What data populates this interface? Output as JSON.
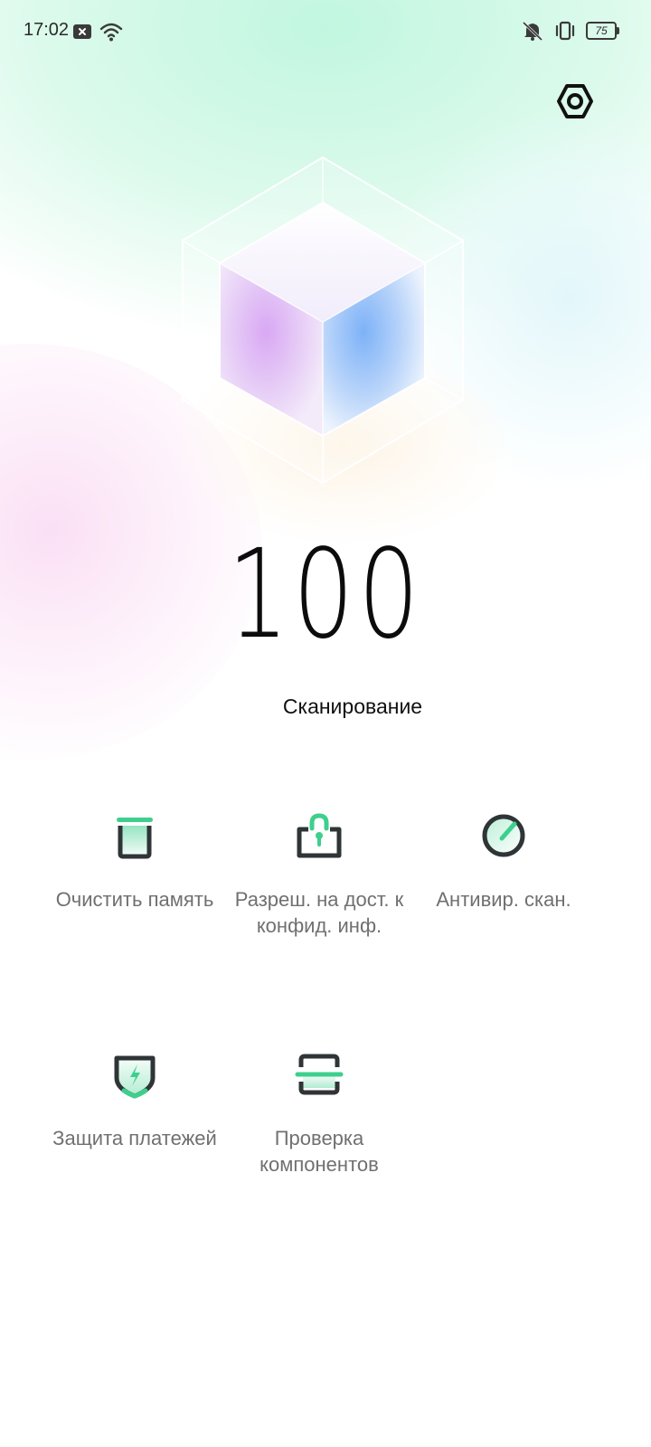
{
  "status_bar": {
    "time": "17:02",
    "battery": "75",
    "icons": [
      "notification-x-icon",
      "wifi-icon",
      "mute-icon",
      "vibrate-icon",
      "battery-icon"
    ]
  },
  "header": {
    "settings_icon": "settings-hexagon-icon"
  },
  "score": {
    "value": "100"
  },
  "scan": {
    "label": "Сканирование"
  },
  "tools": [
    {
      "label": "Очистить память",
      "icon": "trash-icon"
    },
    {
      "label": "Разреш. на дост. к конфид. инф.",
      "icon": "privacy-lock-icon"
    },
    {
      "label": "Антивир. скан.",
      "icon": "antivirus-gauge-icon"
    },
    {
      "label": "Защита платежей",
      "icon": "payment-shield-icon"
    },
    {
      "label": "Проверка компонентов",
      "icon": "component-scan-icon"
    }
  ],
  "colors": {
    "accent": "#3ecf8e",
    "icon_dark": "#2f3437",
    "label_gray": "#707070"
  }
}
